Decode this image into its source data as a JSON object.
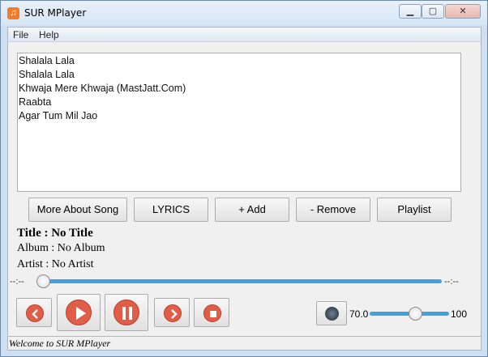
{
  "window": {
    "title": "SUR MPlayer"
  },
  "menu": {
    "items": [
      "File",
      "Help"
    ]
  },
  "playlist": {
    "items": [
      "Shalala Lala",
      "Shalala Lala",
      "Khwaja Mere Khwaja (MastJatt.Com)",
      "Raabta",
      "Agar Tum Mil Jao"
    ]
  },
  "buttons": {
    "about": "More About Song",
    "lyrics": "LYRICS",
    "add": "+ Add",
    "remove": "- Remove",
    "playlist": "Playlist"
  },
  "info": {
    "title": "Title : No Title",
    "album": "Album : No Album",
    "artist": "Artist : No Artist"
  },
  "seek": {
    "elapsed": "--:--",
    "remaining": "--:--",
    "progress": 0.0
  },
  "volume": {
    "min_label": "70.0",
    "max_label": "100",
    "level": 0.57
  },
  "status": {
    "text": "Welcome to SUR MPlayer"
  },
  "colors": {
    "accent": "#3fa3e0",
    "control_icon": "#e05d48"
  },
  "icons": {
    "app": "music-note-icon",
    "prev": "rewind-icon",
    "play": "play-icon",
    "pause": "pause-icon",
    "next": "fast-forward-icon",
    "stop": "stop-icon",
    "volume": "speaker-icon"
  }
}
